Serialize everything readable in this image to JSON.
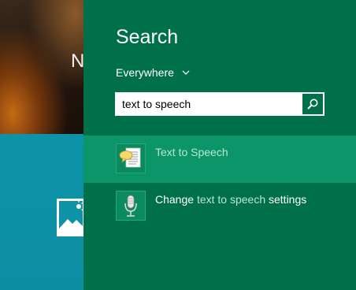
{
  "background": {
    "photo_text": "N"
  },
  "search_panel": {
    "title": "Search",
    "scope": {
      "label": "Everywhere"
    },
    "search": {
      "value": "text to speech",
      "placeholder": ""
    },
    "results": [
      {
        "label": "Text to Speech",
        "icon": "speech-bubble-document-icon",
        "selected": true
      },
      {
        "label_parts": [
          "Change ",
          "text to speech",
          " settings"
        ],
        "icon": "microphone-icon",
        "selected": false
      }
    ]
  },
  "colors": {
    "panel_bg": "#00704b",
    "selected_bg": "#0b9568",
    "tile_bg": "#0c93a8",
    "muted_text": "#b9e6d3"
  }
}
